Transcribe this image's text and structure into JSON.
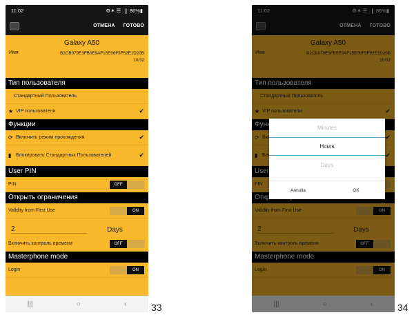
{
  "status": {
    "time": "11:02",
    "icons": "⚙✶ ☰ .❙ 86%▮"
  },
  "appbar": {
    "cancel": "ОТМЕНА",
    "done": "ГОТОВО"
  },
  "name": {
    "label": "Имя",
    "value": "Galaxy A50",
    "id": "B2CB079E3FB0E9AF15E06F5F62E1D20B",
    "count": "10/32"
  },
  "sections": {
    "user_type": "Тип пользователя",
    "functions": "Функции",
    "user_pin": "User PIN",
    "open_limits": "Открыть ограничения",
    "master": "Masterphone mode"
  },
  "rows": {
    "standard_user": "Стандартный Пользователь",
    "vip_user": "VIP пользователи",
    "pass_mode": "Включить режим прохождения",
    "block_std": "Блокировать Стандартных Пользователей",
    "pin": "PIN",
    "validity": "Validity from First Use",
    "days_value": "2",
    "days_unit": "Days",
    "time_control": "Включить контроль времени",
    "login": "Login"
  },
  "toggles": {
    "off": "OFF",
    "on": "ON"
  },
  "dialog": {
    "opt1": "Minutes",
    "opt2": "Hours",
    "opt3": "Days",
    "cancel": "Annulla",
    "ok": "OK"
  },
  "page_numbers": {
    "left": "33",
    "right": "34"
  },
  "colors": {
    "background": "#f9b82b",
    "bar": "#161616",
    "accent": "#4fa3c9"
  }
}
